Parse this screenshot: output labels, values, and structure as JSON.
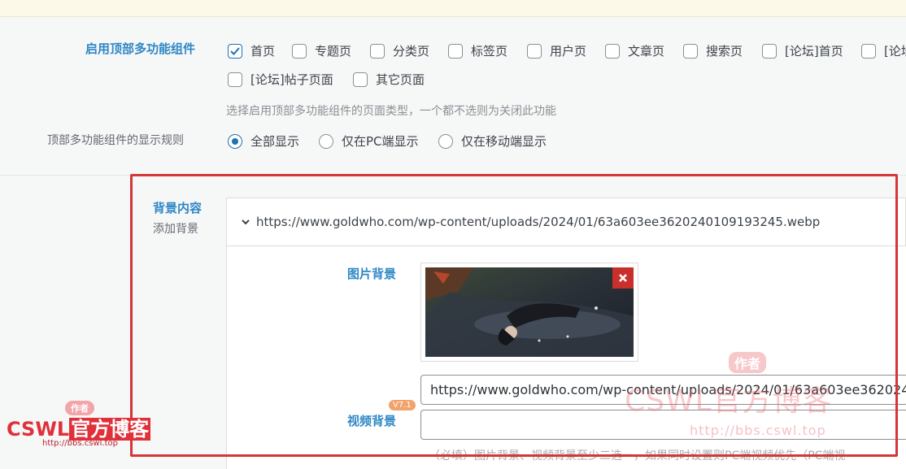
{
  "settings": {
    "enable_label": "启用顶部多功能组件",
    "page_options": [
      {
        "label": "首页",
        "checked": true
      },
      {
        "label": "专题页",
        "checked": false
      },
      {
        "label": "分类页",
        "checked": false
      },
      {
        "label": "标签页",
        "checked": false
      },
      {
        "label": "用户页",
        "checked": false
      },
      {
        "label": "文章页",
        "checked": false
      },
      {
        "label": "搜索页",
        "checked": false
      },
      {
        "label": "[论坛]首页",
        "checked": false
      },
      {
        "label": "[论坛",
        "checked": false
      },
      {
        "label": "[论坛]帖子页面",
        "checked": false
      },
      {
        "label": "其它页面",
        "checked": false
      }
    ],
    "enable_hint": "选择启用顶部多功能组件的页面类型，一个都不选则为关闭此功能",
    "display_rule_label": "顶部多功能组件的显示规则",
    "display_options": [
      {
        "label": "全部显示",
        "checked": true
      },
      {
        "label": "仅在PC端显示",
        "checked": false
      },
      {
        "label": "仅在移动端显示",
        "checked": false
      }
    ]
  },
  "background": {
    "title": "背景内容",
    "subtitle": "添加背景",
    "item_url": "https://www.goldwho.com/wp-content/uploads/2024/01/63a603ee3620240109193245.webp",
    "image_label": "图片背景",
    "image_input_value": "https://www.goldwho.com/wp-content/uploads/2024/01/63a603ee362024(",
    "video_label": "视频背景",
    "video_badge": "V7.1",
    "video_input_value": "",
    "note": "（必填）图片背景、视频背景至少二选一，如果同时设置则PC端视频优先（PC端视"
  },
  "watermark": {
    "author_tag": "作者",
    "brand_plain": "CSWL",
    "brand_highlight": "官方博客",
    "url": "http://bbs.cswl.top"
  }
}
